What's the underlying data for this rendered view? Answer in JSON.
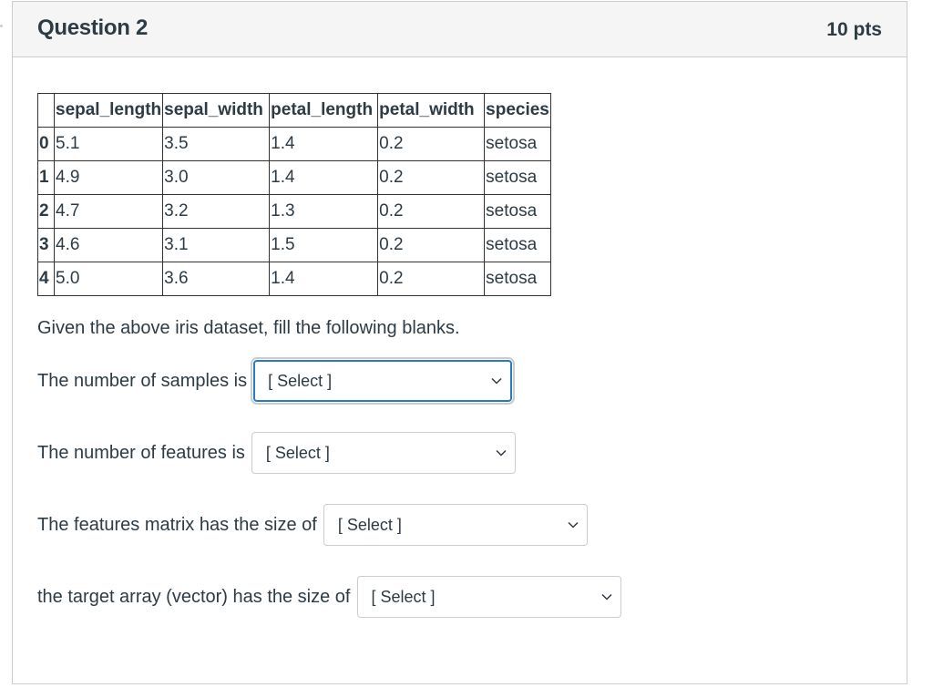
{
  "question": {
    "title": "Question 2",
    "points": "10 pts"
  },
  "table": {
    "headers": [
      "",
      "sepal_length",
      "sepal_width",
      "petal_length",
      "petal_width",
      "species"
    ],
    "rows": [
      {
        "index": "0",
        "sepal_length": "5.1",
        "sepal_width": "3.5",
        "petal_length": "1.4",
        "petal_width": "0.2",
        "species": "setosa"
      },
      {
        "index": "1",
        "sepal_length": "4.9",
        "sepal_width": "3.0",
        "petal_length": "1.4",
        "petal_width": "0.2",
        "species": "setosa"
      },
      {
        "index": "2",
        "sepal_length": "4.7",
        "sepal_width": "3.2",
        "petal_length": "1.3",
        "petal_width": "0.2",
        "species": "setosa"
      },
      {
        "index": "3",
        "sepal_length": "4.6",
        "sepal_width": "3.1",
        "petal_length": "1.5",
        "petal_width": "0.2",
        "species": "setosa"
      },
      {
        "index": "4",
        "sepal_length": "5.0",
        "sepal_width": "3.6",
        "petal_length": "1.4",
        "petal_width": "0.2",
        "species": "setosa"
      }
    ]
  },
  "prompt": "Given the above iris dataset, fill the following blanks.",
  "blanks": [
    {
      "label": "The number of samples is",
      "selected": "[ Select ]",
      "focused": true
    },
    {
      "label": "The number of features is",
      "selected": "[ Select ]",
      "focused": false
    },
    {
      "label": "The features matrix has the size of",
      "selected": "[ Select ]",
      "focused": false
    },
    {
      "label": "the target array (vector) has the size of",
      "selected": "[ Select ]",
      "focused": false
    }
  ],
  "icons": {
    "dropdown": "chevron-down-icon"
  },
  "colors": {
    "focus_border": "#2b7abc",
    "header_bg": "#f5f5f5",
    "text": "#2d3b45",
    "border": "#c7cdd1"
  }
}
